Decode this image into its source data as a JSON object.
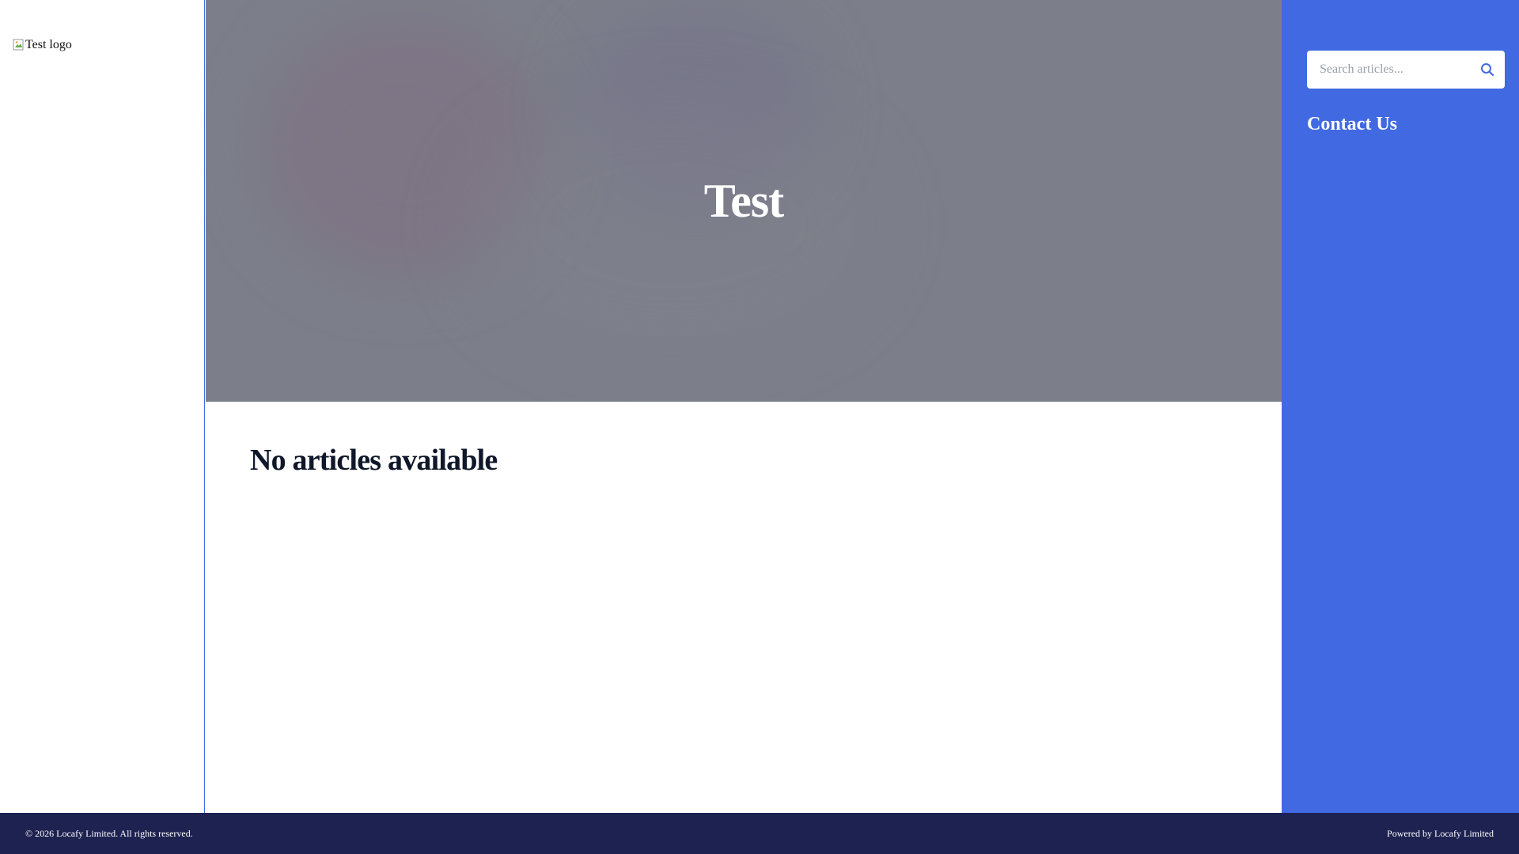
{
  "logo": {
    "alt_text": "Test logo"
  },
  "hero": {
    "title": "Test"
  },
  "main": {
    "empty_message": "No articles available"
  },
  "sidebar": {
    "search_placeholder": "Search articles...",
    "contact_label": "Contact Us",
    "search_icon": "search-icon"
  },
  "footer": {
    "copyright": "© 2026 Locafy Limited. All rights reserved.",
    "powered_by": "Powered by Locafy Limited"
  },
  "colors": {
    "accent": "#4169e1",
    "footer_bg": "#1e2250",
    "hero_overlay": "#7c7f8a",
    "heading_text": "#0f172a"
  }
}
